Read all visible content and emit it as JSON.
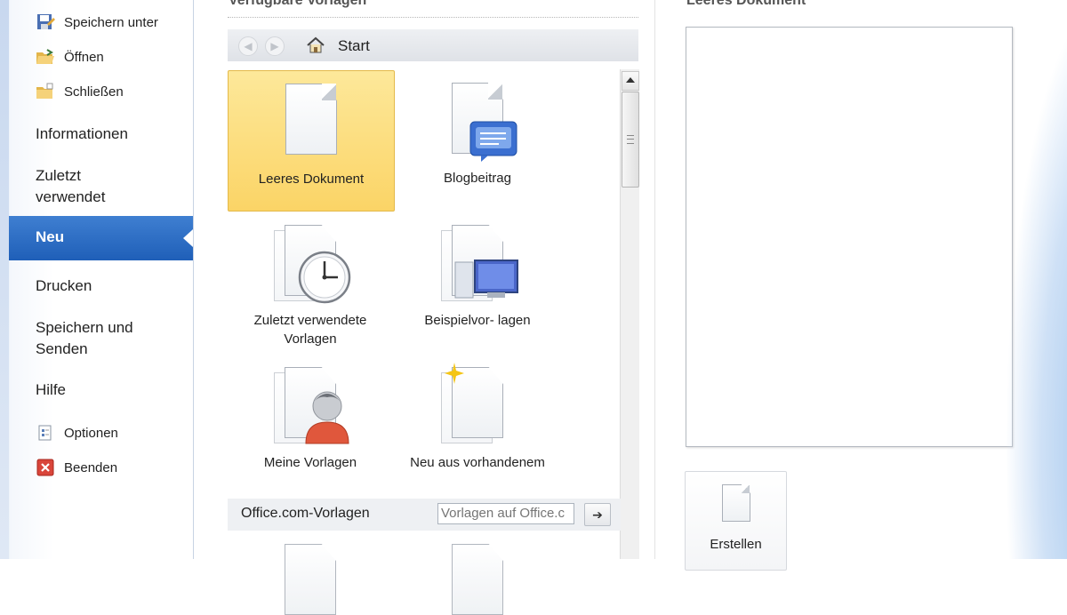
{
  "nav": {
    "save_as": "Speichern unter",
    "open": "Öffnen",
    "close": "Schließen",
    "info": "Informationen",
    "recent_line1": "Zuletzt",
    "recent_line2": "verwendet",
    "new": "Neu",
    "print": "Drucken",
    "save_send_line1": "Speichern und",
    "save_send_line2": "Senden",
    "help": "Hilfe",
    "options": "Optionen",
    "exit": "Beenden"
  },
  "templates": {
    "title": "Verfügbare Vorlagen",
    "breadcrumb": "Start",
    "tiles": {
      "blank": "Leeres Dokument",
      "blog": "Blogbeitrag",
      "recent_line1": "Zuletzt verwendete",
      "recent_line2": "Vorlagen",
      "samples": "Beispielvor- lagen",
      "mine": "Meine Vorlagen",
      "from_existing": "Neu aus vorhandenem"
    },
    "office_com": {
      "label": "Office.com-Vorlagen",
      "search_placeholder": "Vorlagen auf Office.c",
      "go": "➔"
    }
  },
  "preview": {
    "title": "Leeres Dokument",
    "create_label": "Erstellen"
  },
  "colors": {
    "nav_active": "#2a6cc4",
    "tile_selected": "#fbd466",
    "accent_blue": "#3a7bd5"
  }
}
